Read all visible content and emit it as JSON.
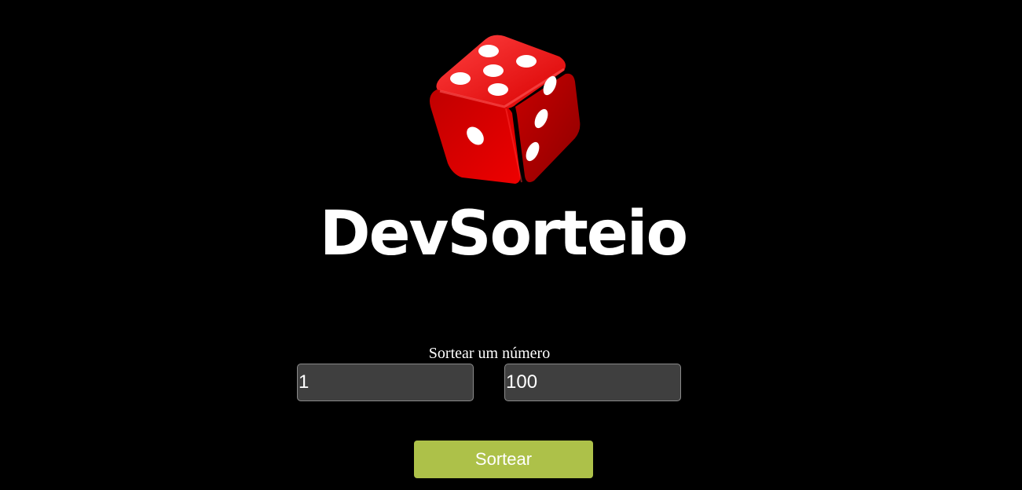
{
  "app": {
    "brand_title": "DevSorteio",
    "logo_icon": "dice-icon"
  },
  "form": {
    "prompt_label": "Sortear um número",
    "min_value": "1",
    "max_value": "100",
    "submit_label": "Sortear"
  },
  "colors": {
    "background": "#000000",
    "input_background": "#3f3f3f",
    "button_background": "#adc149",
    "dice_red": "#e00000"
  }
}
